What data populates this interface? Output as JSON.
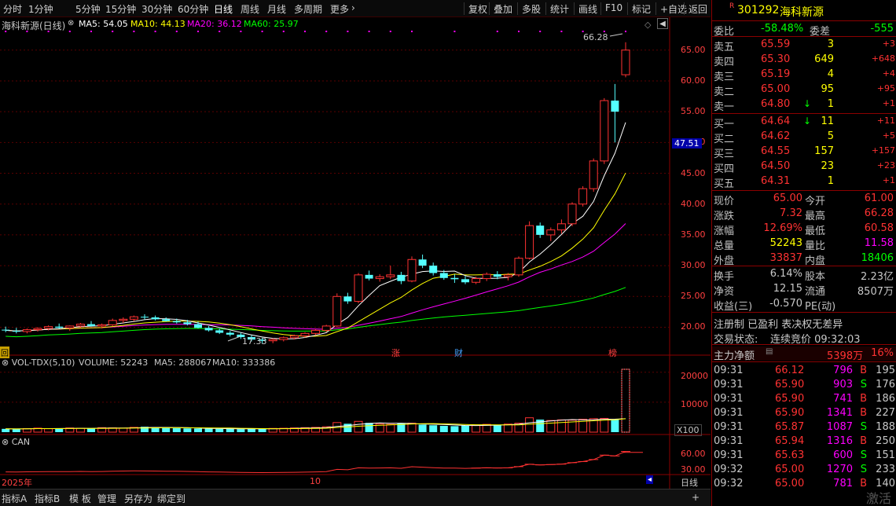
{
  "toolbar": {
    "periods": [
      "分时",
      "1分钟",
      "5分钟",
      "15分钟",
      "30分钟",
      "60分钟",
      "日线",
      "周线",
      "月线",
      "多周期",
      "更多"
    ],
    "active_period": "日线",
    "tools": [
      "复权",
      "叠加",
      "多股",
      "统计",
      "画线",
      "F10",
      "标记",
      "+自选",
      "返回"
    ]
  },
  "chart": {
    "title": "海科新源(日线)",
    "ma": [
      {
        "name": "MA5",
        "text": "MA5: 54.05",
        "color": "#ffffff"
      },
      {
        "name": "MA10",
        "text": "MA10: 44.13",
        "color": "#ffff00"
      },
      {
        "name": "MA20",
        "text": "MA20: 36.12",
        "color": "#ff00ff"
      },
      {
        "name": "MA60",
        "text": "MA60: 25.97",
        "color": "#00ff00"
      }
    ],
    "price_axis": [
      "65.00",
      "60.00",
      "55.00",
      "50.00",
      "45.00",
      "40.00",
      "35.00",
      "30.00",
      "25.00",
      "20.00"
    ],
    "high_label": "66.28",
    "low_label": "17.33",
    "current_price_tag": "47.51",
    "events": [
      "回",
      "涨",
      "财",
      "榜"
    ],
    "volume_header": {
      "name": "VOL-TDX(5,10)",
      "volume": "VOLUME: 52243",
      "ma5": "MA5: 288067",
      "ma10": "MA10: 333386"
    },
    "volume_axis": [
      "20000",
      "10000"
    ],
    "volume_unit": "X100",
    "can_header": "CAN",
    "can_axis": [
      "60.00",
      "30.00"
    ],
    "date_labels": [
      "2025年",
      "10"
    ],
    "period_label": "日线",
    "colors": {
      "up": "#ff3232",
      "down": "#54ffff",
      "grid": "#5a0000",
      "axis_text": "#ff4040"
    }
  },
  "chart_data": {
    "type": "candlestick",
    "ohlc": [
      [
        19.6,
        20.1,
        19.2,
        19.5
      ],
      [
        19.4,
        19.9,
        19.0,
        19.3
      ],
      [
        19.3,
        19.8,
        19.0,
        19.6
      ],
      [
        19.6,
        20.0,
        19.3,
        19.8
      ],
      [
        19.8,
        20.3,
        19.5,
        20.1
      ],
      [
        20.1,
        20.6,
        19.8,
        19.9
      ],
      [
        19.9,
        20.3,
        19.4,
        20.2
      ],
      [
        20.2,
        20.7,
        19.9,
        20.5
      ],
      [
        20.5,
        21.0,
        20.1,
        20.2
      ],
      [
        20.2,
        20.6,
        19.8,
        20.4
      ],
      [
        20.4,
        21.4,
        20.2,
        21.1
      ],
      [
        21.1,
        21.6,
        20.7,
        21.3
      ],
      [
        21.3,
        21.9,
        21.0,
        21.7
      ],
      [
        21.7,
        22.1,
        21.3,
        21.6
      ],
      [
        21.6,
        21.9,
        21.1,
        21.3
      ],
      [
        21.3,
        21.6,
        20.9,
        21.0
      ],
      [
        21.0,
        21.4,
        20.6,
        20.8
      ],
      [
        20.8,
        21.2,
        20.3,
        20.5
      ],
      [
        20.5,
        20.9,
        19.8,
        19.9
      ],
      [
        19.9,
        20.2,
        19.3,
        19.5
      ],
      [
        19.5,
        19.8,
        18.9,
        19.1
      ],
      [
        19.1,
        19.4,
        18.5,
        18.8
      ],
      [
        18.8,
        19.1,
        18.1,
        18.4
      ],
      [
        18.4,
        18.7,
        17.7,
        18.0
      ],
      [
        18.0,
        18.3,
        17.33,
        17.8
      ],
      [
        17.8,
        18.2,
        17.4,
        18.0
      ],
      [
        18.0,
        18.5,
        17.7,
        18.3
      ],
      [
        18.3,
        18.8,
        18.0,
        18.6
      ],
      [
        18.6,
        19.2,
        18.3,
        19.0
      ],
      [
        19.0,
        19.7,
        18.7,
        19.5
      ],
      [
        19.5,
        20.4,
        19.2,
        20.2
      ],
      [
        20.2,
        25.5,
        20.0,
        25.0
      ],
      [
        25.0,
        25.6,
        23.8,
        24.2
      ],
      [
        24.2,
        28.8,
        23.9,
        28.5
      ],
      [
        28.5,
        29.2,
        27.6,
        27.9
      ],
      [
        27.9,
        28.6,
        27.4,
        28.2
      ],
      [
        28.2,
        30.0,
        27.8,
        28.5
      ],
      [
        28.5,
        29.0,
        27.0,
        27.5
      ],
      [
        27.5,
        31.5,
        27.3,
        31.0
      ],
      [
        31.0,
        31.8,
        29.6,
        30.0
      ],
      [
        30.0,
        30.5,
        28.4,
        28.8
      ],
      [
        28.8,
        29.3,
        27.7,
        28.0
      ],
      [
        28.0,
        28.6,
        27.2,
        27.8
      ],
      [
        27.8,
        28.3,
        27.0,
        27.3
      ],
      [
        27.3,
        28.2,
        27.0,
        27.9
      ],
      [
        27.9,
        28.9,
        27.5,
        28.6
      ],
      [
        28.6,
        29.1,
        27.8,
        28.2
      ],
      [
        28.2,
        28.8,
        27.6,
        28.5
      ],
      [
        28.5,
        31.5,
        28.2,
        31.2
      ],
      [
        31.2,
        37.2,
        31.0,
        36.5
      ],
      [
        36.5,
        37.0,
        34.5,
        35.0
      ],
      [
        35.0,
        36.2,
        34.0,
        35.8
      ],
      [
        35.8,
        37.5,
        35.2,
        36.8
      ],
      [
        36.8,
        40.3,
        36.4,
        40.0
      ],
      [
        40.0,
        42.9,
        39.6,
        42.5
      ],
      [
        42.5,
        47.4,
        42.0,
        47.0
      ],
      [
        47.0,
        57.2,
        46.5,
        56.8
      ],
      [
        56.8,
        59.5,
        50.0,
        55.0
      ],
      [
        61.0,
        66.28,
        60.58,
        65.0
      ]
    ],
    "volume": [
      1100,
      1050,
      1200,
      1350,
      1150,
      1250,
      1400,
      1300,
      1200,
      1500,
      1450,
      1350,
      1600,
      1800,
      1700,
      1400,
      1300,
      1250,
      1200,
      1150,
      1100,
      1050,
      1000,
      1150,
      1200,
      1250,
      1300,
      1400,
      1500,
      1600,
      1800,
      3200,
      2800,
      3600,
      3100,
      2700,
      2600,
      2900,
      3000,
      2500,
      2300,
      2100,
      2000,
      2200,
      2400,
      2600,
      2500,
      2700,
      3000,
      4800,
      4200,
      3900,
      4100,
      4000,
      4300,
      4500,
      4600,
      4200,
      21000
    ],
    "price_range": [
      17.0,
      66.5
    ],
    "volume_max": 21000
  },
  "quote": {
    "code": "301292",
    "name": "海科新源",
    "webi_label": "委比",
    "webi": "-58.48%",
    "weicha_label": "委差",
    "weicha": "-555",
    "asks": [
      {
        "label": "卖五",
        "price": "65.59",
        "vol": "3",
        "chg": "+3"
      },
      {
        "label": "卖四",
        "price": "65.30",
        "vol": "649",
        "chg": "+648"
      },
      {
        "label": "卖三",
        "price": "65.19",
        "vol": "4",
        "chg": "+4"
      },
      {
        "label": "卖二",
        "price": "65.00",
        "vol": "95",
        "chg": "+95"
      },
      {
        "label": "卖一",
        "price": "64.80",
        "vol": "1",
        "chg": "+1"
      }
    ],
    "bids": [
      {
        "label": "买一",
        "price": "64.64",
        "vol": "11",
        "chg": "+11"
      },
      {
        "label": "买二",
        "price": "64.62",
        "vol": "5",
        "chg": "+5"
      },
      {
        "label": "买三",
        "price": "64.55",
        "vol": "157",
        "chg": "+157"
      },
      {
        "label": "买四",
        "price": "64.50",
        "vol": "23",
        "chg": "+23"
      },
      {
        "label": "买五",
        "price": "64.31",
        "vol": "1",
        "chg": "+1"
      }
    ],
    "stats": [
      {
        "l1": "现价",
        "v1": "65.00",
        "c1": "#ff3232",
        "l2": "今开",
        "v2": "61.00",
        "c2": "#ff3232"
      },
      {
        "l1": "涨跌",
        "v1": "7.32",
        "c1": "#ff3232",
        "l2": "最高",
        "v2": "66.28",
        "c2": "#ff3232"
      },
      {
        "l1": "涨幅",
        "v1": "12.69%",
        "c1": "#ff3232",
        "l2": "最低",
        "v2": "60.58",
        "c2": "#ff3232"
      },
      {
        "l1": "总量",
        "v1": "52243",
        "c1": "#ffff00",
        "l2": "量比",
        "v2": "11.58",
        "c2": "#ff00ff"
      },
      {
        "l1": "外盘",
        "v1": "33837",
        "c1": "#ff3232",
        "l2": "内盘",
        "v2": "18406",
        "c2": "#00ff00"
      }
    ],
    "stats2": [
      {
        "l1": "换手",
        "v1": "6.14%",
        "l2": "股本",
        "v2": "2.23亿"
      },
      {
        "l1": "净资",
        "v1": "12.15",
        "l2": "流通",
        "v2": "8507万"
      },
      {
        "l1": "收益(三)",
        "v1": "-0.570",
        "l2": "PE(动)",
        "v2": ""
      }
    ],
    "notice": "注册制 已盈利 表决权无差异",
    "trade_status_label": "交易状态:",
    "trade_status": "连续竞价 09:32:03",
    "main_flow_label": "主力净额",
    "main_flow": "5398万",
    "main_flow_pct": "16%"
  },
  "ticks": [
    {
      "time": "09:31",
      "price": "66.12",
      "vol": "796",
      "side": "B",
      "n": "195"
    },
    {
      "time": "09:31",
      "price": "65.90",
      "vol": "903",
      "side": "S",
      "n": "176"
    },
    {
      "time": "09:31",
      "price": "65.90",
      "vol": "741",
      "side": "B",
      "n": "186"
    },
    {
      "time": "09:31",
      "price": "65.90",
      "vol": "1341",
      "side": "B",
      "n": "227"
    },
    {
      "time": "09:31",
      "price": "65.87",
      "vol": "1087",
      "side": "S",
      "n": "188"
    },
    {
      "time": "09:31",
      "price": "65.94",
      "vol": "1316",
      "side": "B",
      "n": "250"
    },
    {
      "time": "09:31",
      "price": "65.63",
      "vol": "600",
      "side": "S",
      "n": "151"
    },
    {
      "time": "09:32",
      "price": "65.00",
      "vol": "1270",
      "side": "S",
      "n": "233"
    },
    {
      "time": "09:32",
      "price": "65.00",
      "vol": "781",
      "side": "B",
      "n": "140"
    }
  ],
  "bottom": {
    "tabs": [
      "指标A",
      "指标B",
      "模 板",
      "管理",
      "另存为",
      "绑定到"
    ],
    "activate": "激活"
  }
}
